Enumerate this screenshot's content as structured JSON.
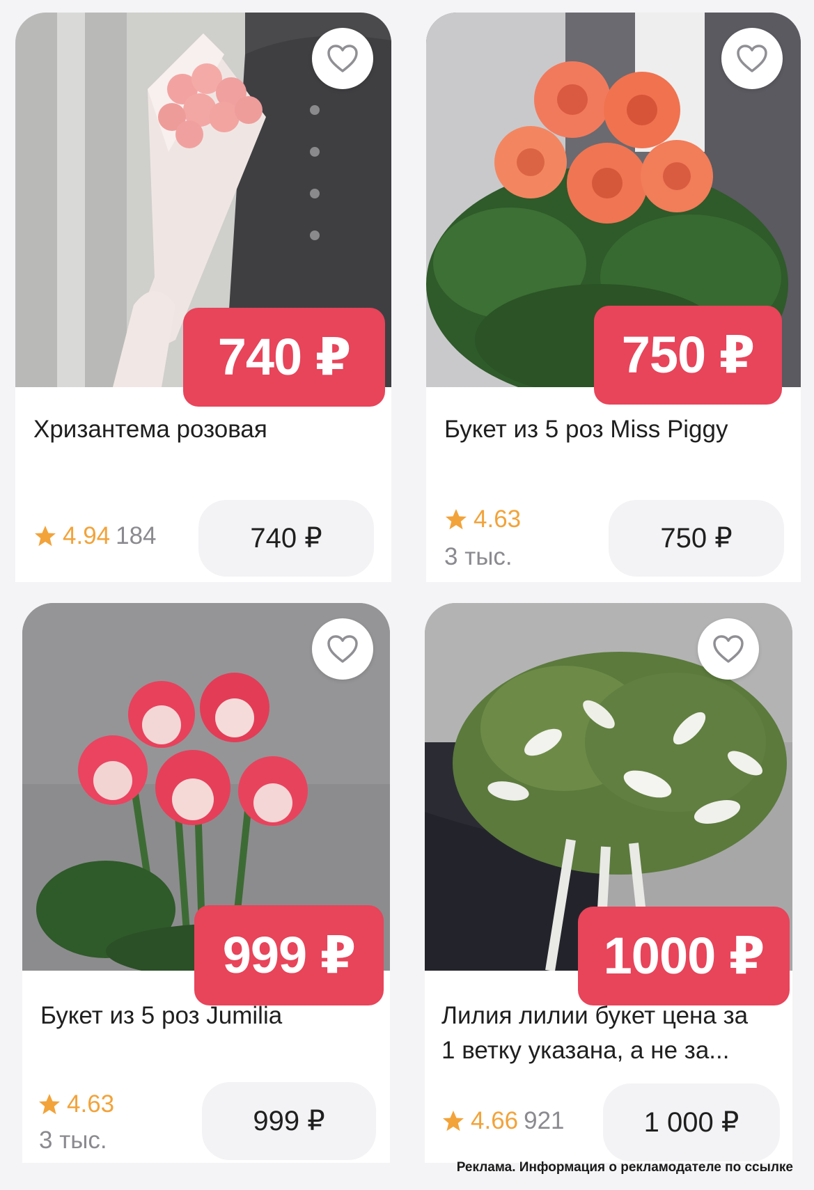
{
  "products": [
    {
      "image": "pink-chrysanthemum-bouquet",
      "badge_price": "740 ₽",
      "title": "Хризантема розовая",
      "rating": "4.94",
      "reviews": "184",
      "button_price": "740 ₽",
      "favorite_icon": "heart-outline-icon"
    },
    {
      "image": "orange-roses-bouquet",
      "badge_price": "750 ₽",
      "title": "Букет из 5 роз Miss Piggy",
      "rating": "4.63",
      "reviews": "3 тыс.",
      "button_price": "750 ₽",
      "favorite_icon": "heart-outline-icon"
    },
    {
      "image": "pink-white-roses-bouquet",
      "badge_price": "999 ₽",
      "title": "Букет из 5 роз Jumilia",
      "rating": "4.63",
      "reviews": "3 тыс.",
      "button_price": "999 ₽",
      "favorite_icon": "heart-outline-icon"
    },
    {
      "image": "white-lilies-bouquet",
      "badge_price": "1000 ₽",
      "title_line1": "Лилия лилии букет цена за",
      "title_line2": "1 ветку указана, а не за...",
      "rating": "4.66",
      "reviews": "921",
      "button_price": "1 000 ₽",
      "favorite_icon": "heart-outline-icon"
    }
  ],
  "footer": {
    "ad_notice": "Реклама. Информация о рекламодателе по ссылке"
  },
  "colors": {
    "badge": "#e8445a",
    "star": "#f2a33a",
    "muted_text": "#8a8a8f"
  }
}
